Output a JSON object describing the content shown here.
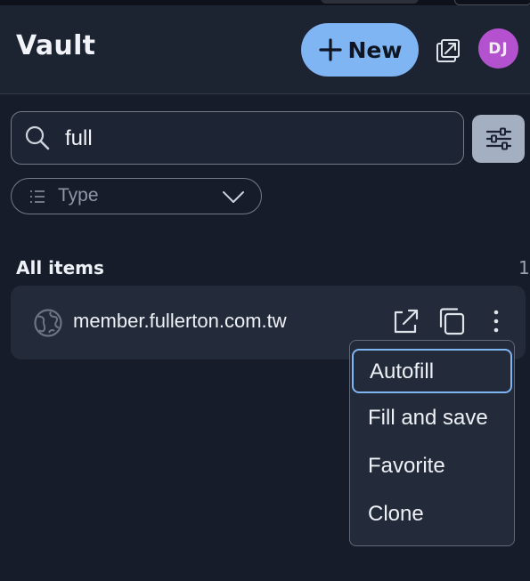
{
  "header": {
    "title": "Vault",
    "new_label": "New",
    "avatar_initials": "DJ",
    "avatar_color": "#b351cf",
    "accent": "#7fb5f3"
  },
  "search": {
    "value": "full",
    "placeholder": "Search"
  },
  "filters": {
    "type_label": "Type"
  },
  "list": {
    "section_title": "All items",
    "count": "1",
    "items": [
      {
        "name": "member.fullerton.com.tw",
        "icon": "globe-icon"
      }
    ]
  },
  "menu": {
    "items": [
      {
        "label": "Autofill",
        "selected": true
      },
      {
        "label": "Fill and save"
      },
      {
        "label": "Favorite"
      },
      {
        "label": "Clone"
      }
    ]
  }
}
